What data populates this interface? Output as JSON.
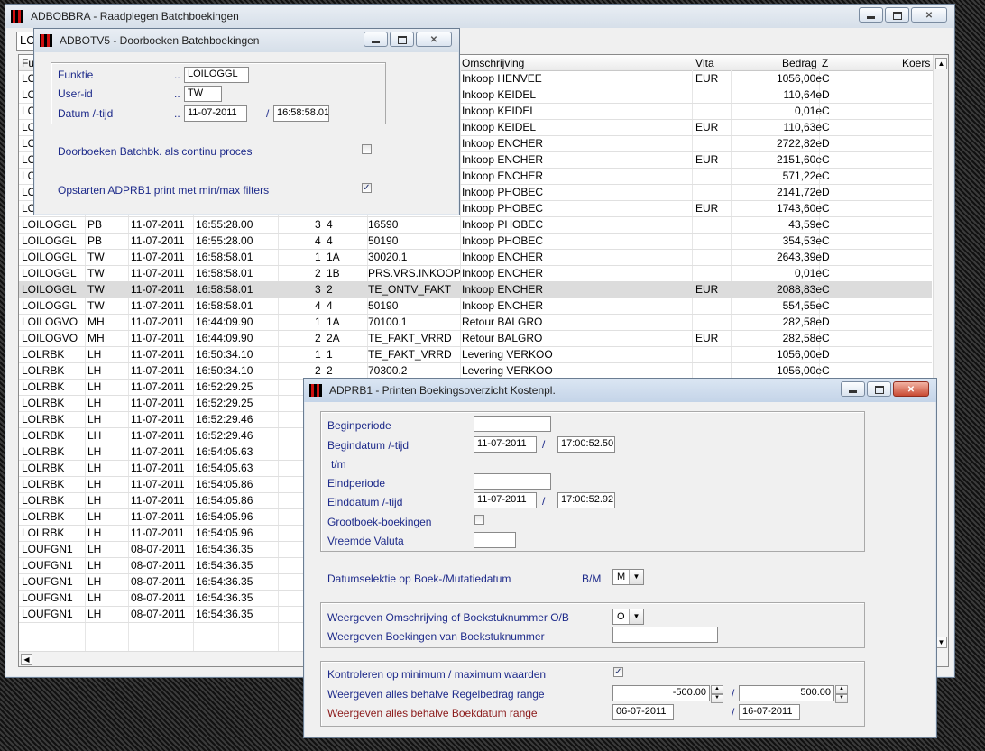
{
  "main_window": {
    "title": "ADBOBBRA - Raadplegen Batchboekingen",
    "top_field_value": "LO",
    "columns": [
      "Fu",
      "Omschrijving",
      "Vlta",
      "Bedrag",
      "Z",
      "Koers"
    ],
    "rows": [
      {
        "c1": "LO",
        "c2": "",
        "c3": "",
        "c4": "",
        "c5": "",
        "c6": "",
        "c7": "",
        "desc": "Inkoop HENVEE",
        "vlta": "EUR",
        "bedrag": "1056,00e",
        "z": "C"
      },
      {
        "c1": "LO",
        "c2": "",
        "c3": "",
        "c4": "",
        "c5": "",
        "c6": "",
        "c7": "",
        "desc": "Inkoop KEIDEL",
        "vlta": "",
        "bedrag": "110,64e",
        "z": "D"
      },
      {
        "c1": "LO",
        "c2": "",
        "c3": "",
        "c4": "",
        "c5": "",
        "c6": "",
        "c7": "",
        "desc": "Inkoop KEIDEL",
        "vlta": "",
        "bedrag": "0,01e",
        "z": "C"
      },
      {
        "c1": "LO",
        "c2": "",
        "c3": "",
        "c4": "",
        "c5": "",
        "c6": "",
        "c7": "",
        "desc": "Inkoop KEIDEL",
        "vlta": "EUR",
        "bedrag": "110,63e",
        "z": "C"
      },
      {
        "c1": "LO",
        "c2": "",
        "c3": "",
        "c4": "",
        "c5": "",
        "c6": "",
        "c7": "",
        "desc": "Inkoop ENCHER",
        "vlta": "",
        "bedrag": "2722,82e",
        "z": "D"
      },
      {
        "c1": "LO",
        "c2": "",
        "c3": "",
        "c4": "",
        "c5": "",
        "c6": "",
        "c7": "",
        "desc": "Inkoop ENCHER",
        "vlta": "EUR",
        "bedrag": "2151,60e",
        "z": "C"
      },
      {
        "c1": "LO",
        "c2": "",
        "c3": "",
        "c4": "",
        "c5": "",
        "c6": "",
        "c7": "",
        "desc": "Inkoop ENCHER",
        "vlta": "",
        "bedrag": "571,22e",
        "z": "C"
      },
      {
        "c1": "LO",
        "c2": "",
        "c3": "",
        "c4": "",
        "c5": "",
        "c6": "",
        "c7": "",
        "desc": "Inkoop PHOBEC",
        "vlta": "",
        "bedrag": "2141,72e",
        "z": "D"
      },
      {
        "c1": "LO",
        "c2": "",
        "c3": "",
        "c4": "",
        "c5": "",
        "c6": "",
        "c7": "",
        "desc": "Inkoop PHOBEC",
        "vlta": "EUR",
        "bedrag": "1743,60e",
        "z": "C"
      },
      {
        "c1": "LOILOGGL",
        "c2": "PB",
        "c3": "11-07-2011",
        "c4": "16:55:28.00",
        "c5": "3",
        "c6": "4",
        "c7": "16590",
        "desc": "Inkoop PHOBEC",
        "vlta": "",
        "bedrag": "43,59e",
        "z": "C"
      },
      {
        "c1": "LOILOGGL",
        "c2": "PB",
        "c3": "11-07-2011",
        "c4": "16:55:28.00",
        "c5": "4",
        "c6": "4",
        "c7": "50190",
        "desc": "Inkoop PHOBEC",
        "vlta": "",
        "bedrag": "354,53e",
        "z": "C"
      },
      {
        "c1": "LOILOGGL",
        "c2": "TW",
        "c3": "11-07-2011",
        "c4": "16:58:58.01",
        "c5": "1",
        "c6": "1A",
        "c7": "30020.1",
        "desc": "Inkoop ENCHER",
        "vlta": "",
        "bedrag": "2643,39e",
        "z": "D"
      },
      {
        "c1": "LOILOGGL",
        "c2": "TW",
        "c3": "11-07-2011",
        "c4": "16:58:58.01",
        "c5": "2",
        "c6": "1B",
        "c7": "PRS.VRS.INKOOP",
        "desc": "Inkoop ENCHER",
        "vlta": "",
        "bedrag": "0,01e",
        "z": "C"
      },
      {
        "c1": "LOILOGGL",
        "c2": "TW",
        "c3": "11-07-2011",
        "c4": "16:58:58.01",
        "c5": "3",
        "c6": "2",
        "c7": "TE_ONTV_FAKT",
        "desc": "Inkoop ENCHER",
        "vlta": "EUR",
        "bedrag": "2088,83e",
        "z": "C"
      },
      {
        "c1": "LOILOGGL",
        "c2": "TW",
        "c3": "11-07-2011",
        "c4": "16:58:58.01",
        "c5": "4",
        "c6": "4",
        "c7": "50190",
        "desc": "Inkoop ENCHER",
        "vlta": "",
        "bedrag": "554,55e",
        "z": "C"
      },
      {
        "c1": "LOILOGVO",
        "c2": "MH",
        "c3": "11-07-2011",
        "c4": "16:44:09.90",
        "c5": "1",
        "c6": "1A",
        "c7": "70100.1",
        "desc": "Retour BALGRO",
        "vlta": "",
        "bedrag": "282,58e",
        "z": "D"
      },
      {
        "c1": "LOILOGVO",
        "c2": "MH",
        "c3": "11-07-2011",
        "c4": "16:44:09.90",
        "c5": "2",
        "c6": "2A",
        "c7": "TE_FAKT_VRRD",
        "desc": "Retour BALGRO",
        "vlta": "EUR",
        "bedrag": "282,58e",
        "z": "C"
      },
      {
        "c1": "LOLRBK",
        "c2": "LH",
        "c3": "11-07-2011",
        "c4": "16:50:34.10",
        "c5": "1",
        "c6": "1",
        "c7": "TE_FAKT_VRRD",
        "desc": "Levering VERKOO",
        "vlta": "",
        "bedrag": "1056,00e",
        "z": "D"
      },
      {
        "c1": "LOLRBK",
        "c2": "LH",
        "c3": "11-07-2011",
        "c4": "16:50:34.10",
        "c5": "2",
        "c6": "2",
        "c7": "70300.2",
        "desc": "Levering VERKOO",
        "vlta": "",
        "bedrag": "1056,00e",
        "z": "C"
      },
      {
        "c1": "LOLRBK",
        "c2": "LH",
        "c3": "11-07-2011",
        "c4": "16:52:29.25",
        "c5": "",
        "c6": "",
        "c7": "",
        "desc": "",
        "vlta": "",
        "bedrag": "",
        "z": ""
      },
      {
        "c1": "LOLRBK",
        "c2": "LH",
        "c3": "11-07-2011",
        "c4": "16:52:29.25",
        "c5": "",
        "c6": "",
        "c7": "",
        "desc": "",
        "vlta": "",
        "bedrag": "",
        "z": ""
      },
      {
        "c1": "LOLRBK",
        "c2": "LH",
        "c3": "11-07-2011",
        "c4": "16:52:29.46",
        "c5": "",
        "c6": "",
        "c7": "",
        "desc": "",
        "vlta": "",
        "bedrag": "",
        "z": ""
      },
      {
        "c1": "LOLRBK",
        "c2": "LH",
        "c3": "11-07-2011",
        "c4": "16:52:29.46",
        "c5": "",
        "c6": "",
        "c7": "",
        "desc": "",
        "vlta": "",
        "bedrag": "",
        "z": ""
      },
      {
        "c1": "LOLRBK",
        "c2": "LH",
        "c3": "11-07-2011",
        "c4": "16:54:05.63",
        "c5": "",
        "c6": "",
        "c7": "",
        "desc": "",
        "vlta": "",
        "bedrag": "",
        "z": ""
      },
      {
        "c1": "LOLRBK",
        "c2": "LH",
        "c3": "11-07-2011",
        "c4": "16:54:05.63",
        "c5": "",
        "c6": "",
        "c7": "",
        "desc": "",
        "vlta": "",
        "bedrag": "",
        "z": ""
      },
      {
        "c1": "LOLRBK",
        "c2": "LH",
        "c3": "11-07-2011",
        "c4": "16:54:05.86",
        "c5": "",
        "c6": "",
        "c7": "",
        "desc": "",
        "vlta": "",
        "bedrag": "",
        "z": ""
      },
      {
        "c1": "LOLRBK",
        "c2": "LH",
        "c3": "11-07-2011",
        "c4": "16:54:05.86",
        "c5": "",
        "c6": "",
        "c7": "",
        "desc": "",
        "vlta": "",
        "bedrag": "",
        "z": ""
      },
      {
        "c1": "LOLRBK",
        "c2": "LH",
        "c3": "11-07-2011",
        "c4": "16:54:05.96",
        "c5": "",
        "c6": "",
        "c7": "",
        "desc": "",
        "vlta": "",
        "bedrag": "",
        "z": ""
      },
      {
        "c1": "LOLRBK",
        "c2": "LH",
        "c3": "11-07-2011",
        "c4": "16:54:05.96",
        "c5": "",
        "c6": "",
        "c7": "",
        "desc": "",
        "vlta": "",
        "bedrag": "",
        "z": ""
      },
      {
        "c1": "LOUFGN1",
        "c2": "LH",
        "c3": "08-07-2011",
        "c4": "16:54:36.35",
        "c5": "",
        "c6": "",
        "c7": "",
        "desc": "",
        "vlta": "",
        "bedrag": "",
        "z": ""
      },
      {
        "c1": "LOUFGN1",
        "c2": "LH",
        "c3": "08-07-2011",
        "c4": "16:54:36.35",
        "c5": "",
        "c6": "",
        "c7": "",
        "desc": "",
        "vlta": "",
        "bedrag": "",
        "z": ""
      },
      {
        "c1": "LOUFGN1",
        "c2": "LH",
        "c3": "08-07-2011",
        "c4": "16:54:36.35",
        "c5": "",
        "c6": "",
        "c7": "",
        "desc": "",
        "vlta": "",
        "bedrag": "",
        "z": ""
      },
      {
        "c1": "LOUFGN1",
        "c2": "LH",
        "c3": "08-07-2011",
        "c4": "16:54:36.35",
        "c5": "",
        "c6": "",
        "c7": "",
        "desc": "",
        "vlta": "",
        "bedrag": "",
        "z": ""
      },
      {
        "c1": "LOUFGN1",
        "c2": "LH",
        "c3": "08-07-2011",
        "c4": "16:54:36.35",
        "c5": "",
        "c6": "",
        "c7": "",
        "desc": "",
        "vlta": "",
        "bedrag": "",
        "z": ""
      }
    ],
    "selected_row": 13
  },
  "dialog1": {
    "title": "ADBOTV5 - Doorboeken Batchboekingen",
    "funktie_label": "Funktie",
    "funktie_value": "LOILOGGL",
    "userid_label": "User-id",
    "userid_value": "TW",
    "datum_label": "Datum /-tijd",
    "datum_value": "11-07-2011",
    "tijd_value": "16:58:58.01",
    "dots": "..",
    "slash": "/",
    "continu_label": "Doorboeken Batchbk. als continu proces",
    "opstarten_label": "Opstarten ADPRB1 print met min/max filters",
    "check_mark": "✓"
  },
  "dialog2": {
    "title": "ADPRB1 - Printen Boekingsoverzicht Kostenpl.",
    "beginperiode_label": "Beginperiode",
    "beginperiode_value": "",
    "begindatum_label": "Begindatum /-tijd",
    "begindatum_value": "11-07-2011",
    "begintijd_value": "17:00:52.50",
    "tm_label": "t/m",
    "eindperiode_label": "Eindperiode",
    "eindperiode_value": "",
    "einddatum_label": "Einddatum /-tijd",
    "einddatum_value": "11-07-2011",
    "eindtijd_value": "17:00:52.92",
    "grootboek_label": "Grootboek-boekingen",
    "valuta_label": "Vreemde Valuta",
    "valuta_value": "",
    "datumselektie_label": "Datumselektie op Boek-/Mutatiedatum",
    "bm_label": "B/M",
    "bm_value": "M",
    "omschrijving_label": "Weergeven Omschrijving of Boekstuknummer O/B",
    "ob_value": "O",
    "boekstuk_label": "Weergeven Boekingen van Boekstuknummer",
    "boekstuk_value": "",
    "kontroleren_label": "Kontroleren op minimum / maximum waarden",
    "regel_label": "Weergeven alles behalve Regelbedrag range",
    "regel_min": "-500.00",
    "regel_max": "500.00",
    "boekdatum_label": "Weergeven alles behalve Boekdatum range",
    "boekdatum_min": "06-07-2011",
    "boekdatum_max": "16-07-2011",
    "slash": "/",
    "check_mark": "✓"
  }
}
